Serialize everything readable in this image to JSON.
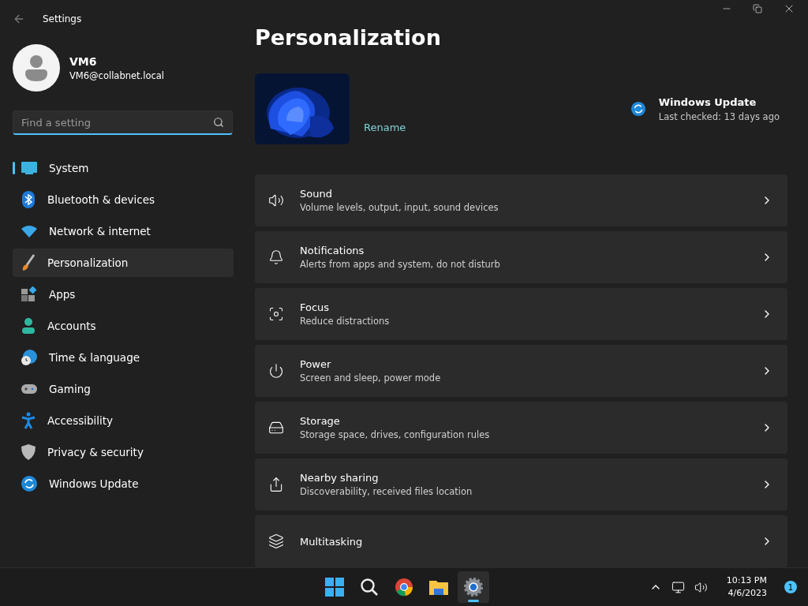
{
  "window": {
    "title": "Settings"
  },
  "account": {
    "name": "VM6",
    "email": "VM6@collabnet.local"
  },
  "search": {
    "placeholder": "Find a setting"
  },
  "sidebar": {
    "items": [
      {
        "label": "System",
        "selected": true,
        "highlighted": false
      },
      {
        "label": "Bluetooth & devices",
        "selected": false,
        "highlighted": false
      },
      {
        "label": "Network & internet",
        "selected": false,
        "highlighted": false
      },
      {
        "label": "Personalization",
        "selected": false,
        "highlighted": true
      },
      {
        "label": "Apps",
        "selected": false,
        "highlighted": false
      },
      {
        "label": "Accounts",
        "selected": false,
        "highlighted": false
      },
      {
        "label": "Time & language",
        "selected": false,
        "highlighted": false
      },
      {
        "label": "Gaming",
        "selected": false,
        "highlighted": false
      },
      {
        "label": "Accessibility",
        "selected": false,
        "highlighted": false
      },
      {
        "label": "Privacy & security",
        "selected": false,
        "highlighted": false
      },
      {
        "label": "Windows Update",
        "selected": false,
        "highlighted": false
      }
    ]
  },
  "page": {
    "title": "Personalization",
    "device": {
      "rename": "Rename"
    },
    "update": {
      "title": "Windows Update",
      "status": "Last checked: 13 days ago"
    },
    "cards": [
      {
        "title": "Sound",
        "subtitle": "Volume levels, output, input, sound devices"
      },
      {
        "title": "Notifications",
        "subtitle": "Alerts from apps and system, do not disturb"
      },
      {
        "title": "Focus",
        "subtitle": "Reduce distractions"
      },
      {
        "title": "Power",
        "subtitle": "Screen and sleep, power mode"
      },
      {
        "title": "Storage",
        "subtitle": "Storage space, drives, configuration rules"
      },
      {
        "title": "Nearby sharing",
        "subtitle": "Discoverability, received files location"
      },
      {
        "title": "Multitasking"
      }
    ]
  },
  "taskbar": {
    "apps": [
      {
        "selected": false
      },
      {
        "selected": false
      },
      {
        "selected": false
      },
      {
        "selected": false
      },
      {
        "selected": true
      }
    ],
    "time": "10:13 PM",
    "date": "4/6/2023",
    "badge": "1"
  }
}
